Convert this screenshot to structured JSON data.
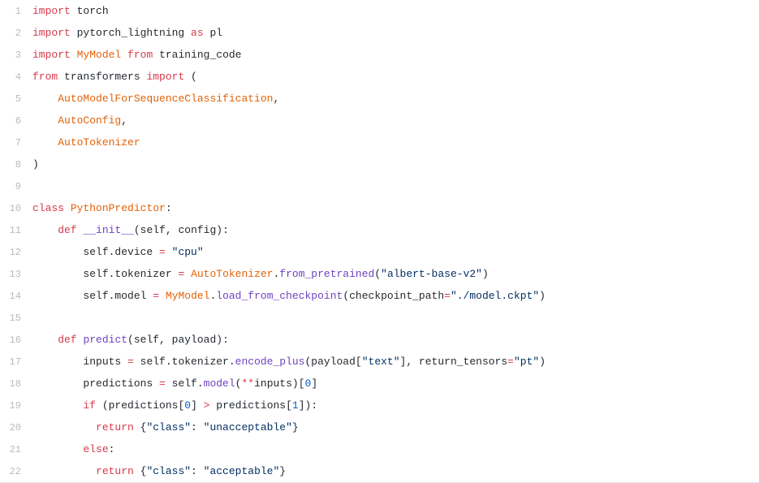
{
  "lines": [
    {
      "n": "1",
      "tokens": [
        {
          "c": "kw",
          "t": "import"
        },
        {
          "c": "plain",
          "t": " torch"
        }
      ]
    },
    {
      "n": "2",
      "tokens": [
        {
          "c": "kw",
          "t": "import"
        },
        {
          "c": "plain",
          "t": " pytorch_lightning "
        },
        {
          "c": "kw",
          "t": "as"
        },
        {
          "c": "plain",
          "t": " pl"
        }
      ]
    },
    {
      "n": "3",
      "tokens": [
        {
          "c": "kw",
          "t": "import"
        },
        {
          "c": "plain",
          "t": " "
        },
        {
          "c": "cls",
          "t": "MyModel"
        },
        {
          "c": "plain",
          "t": " "
        },
        {
          "c": "kw",
          "t": "from"
        },
        {
          "c": "plain",
          "t": " training_code"
        }
      ]
    },
    {
      "n": "4",
      "tokens": [
        {
          "c": "kw",
          "t": "from"
        },
        {
          "c": "plain",
          "t": " transformers "
        },
        {
          "c": "kw",
          "t": "import"
        },
        {
          "c": "plain",
          "t": " ("
        }
      ]
    },
    {
      "n": "5",
      "tokens": [
        {
          "c": "plain",
          "t": "    "
        },
        {
          "c": "cls",
          "t": "AutoModelForSequenceClassification"
        },
        {
          "c": "plain",
          "t": ","
        }
      ]
    },
    {
      "n": "6",
      "tokens": [
        {
          "c": "plain",
          "t": "    "
        },
        {
          "c": "cls",
          "t": "AutoConfig"
        },
        {
          "c": "plain",
          "t": ","
        }
      ]
    },
    {
      "n": "7",
      "tokens": [
        {
          "c": "plain",
          "t": "    "
        },
        {
          "c": "cls",
          "t": "AutoTokenizer"
        }
      ]
    },
    {
      "n": "8",
      "tokens": [
        {
          "c": "plain",
          "t": ")"
        }
      ]
    },
    {
      "n": "9",
      "tokens": [
        {
          "c": "plain",
          "t": ""
        }
      ]
    },
    {
      "n": "10",
      "tokens": [
        {
          "c": "kw",
          "t": "class"
        },
        {
          "c": "plain",
          "t": " "
        },
        {
          "c": "cls",
          "t": "PythonPredictor"
        },
        {
          "c": "plain",
          "t": ":"
        }
      ]
    },
    {
      "n": "11",
      "tokens": [
        {
          "c": "plain",
          "t": "    "
        },
        {
          "c": "kw",
          "t": "def"
        },
        {
          "c": "plain",
          "t": " "
        },
        {
          "c": "fn",
          "t": "__init__"
        },
        {
          "c": "plain",
          "t": "(self, config):"
        }
      ]
    },
    {
      "n": "12",
      "tokens": [
        {
          "c": "plain",
          "t": "        self.device "
        },
        {
          "c": "kw",
          "t": "="
        },
        {
          "c": "plain",
          "t": " "
        },
        {
          "c": "str",
          "t": "\"cpu\""
        }
      ]
    },
    {
      "n": "13",
      "tokens": [
        {
          "c": "plain",
          "t": "        self.tokenizer "
        },
        {
          "c": "kw",
          "t": "="
        },
        {
          "c": "plain",
          "t": " "
        },
        {
          "c": "cls",
          "t": "AutoTokenizer"
        },
        {
          "c": "plain",
          "t": "."
        },
        {
          "c": "fn",
          "t": "from_pretrained"
        },
        {
          "c": "plain",
          "t": "("
        },
        {
          "c": "str",
          "t": "\"albert-base-v2\""
        },
        {
          "c": "plain",
          "t": ")"
        }
      ]
    },
    {
      "n": "14",
      "tokens": [
        {
          "c": "plain",
          "t": "        self.model "
        },
        {
          "c": "kw",
          "t": "="
        },
        {
          "c": "plain",
          "t": " "
        },
        {
          "c": "cls",
          "t": "MyModel"
        },
        {
          "c": "plain",
          "t": "."
        },
        {
          "c": "fn",
          "t": "load_from_checkpoint"
        },
        {
          "c": "plain",
          "t": "(checkpoint_path"
        },
        {
          "c": "kw",
          "t": "="
        },
        {
          "c": "str",
          "t": "\"./model.ckpt\""
        },
        {
          "c": "plain",
          "t": ")"
        }
      ]
    },
    {
      "n": "15",
      "tokens": [
        {
          "c": "plain",
          "t": ""
        }
      ]
    },
    {
      "n": "16",
      "tokens": [
        {
          "c": "plain",
          "t": "    "
        },
        {
          "c": "kw",
          "t": "def"
        },
        {
          "c": "plain",
          "t": " "
        },
        {
          "c": "fn",
          "t": "predict"
        },
        {
          "c": "plain",
          "t": "(self, payload):"
        }
      ]
    },
    {
      "n": "17",
      "tokens": [
        {
          "c": "plain",
          "t": "        inputs "
        },
        {
          "c": "kw",
          "t": "="
        },
        {
          "c": "plain",
          "t": " self.tokenizer."
        },
        {
          "c": "fn",
          "t": "encode_plus"
        },
        {
          "c": "plain",
          "t": "(payload["
        },
        {
          "c": "str",
          "t": "\"text\""
        },
        {
          "c": "plain",
          "t": "], return_tensors"
        },
        {
          "c": "kw",
          "t": "="
        },
        {
          "c": "str",
          "t": "\"pt\""
        },
        {
          "c": "plain",
          "t": ")"
        }
      ]
    },
    {
      "n": "18",
      "tokens": [
        {
          "c": "plain",
          "t": "        predictions "
        },
        {
          "c": "kw",
          "t": "="
        },
        {
          "c": "plain",
          "t": " self."
        },
        {
          "c": "fn",
          "t": "model"
        },
        {
          "c": "plain",
          "t": "("
        },
        {
          "c": "kw",
          "t": "**"
        },
        {
          "c": "plain",
          "t": "inputs)["
        },
        {
          "c": "num",
          "t": "0"
        },
        {
          "c": "plain",
          "t": "]"
        }
      ]
    },
    {
      "n": "19",
      "tokens": [
        {
          "c": "plain",
          "t": "        "
        },
        {
          "c": "kw",
          "t": "if"
        },
        {
          "c": "plain",
          "t": " (predictions["
        },
        {
          "c": "num",
          "t": "0"
        },
        {
          "c": "plain",
          "t": "] "
        },
        {
          "c": "kw",
          "t": ">"
        },
        {
          "c": "plain",
          "t": " predictions["
        },
        {
          "c": "num",
          "t": "1"
        },
        {
          "c": "plain",
          "t": "]):"
        }
      ]
    },
    {
      "n": "20",
      "tokens": [
        {
          "c": "plain",
          "t": "          "
        },
        {
          "c": "kw",
          "t": "return"
        },
        {
          "c": "plain",
          "t": " {"
        },
        {
          "c": "str",
          "t": "\"class\""
        },
        {
          "c": "plain",
          "t": ": "
        },
        {
          "c": "str",
          "t": "\"unacceptable\""
        },
        {
          "c": "plain",
          "t": "}"
        }
      ]
    },
    {
      "n": "21",
      "tokens": [
        {
          "c": "plain",
          "t": "        "
        },
        {
          "c": "kw",
          "t": "else"
        },
        {
          "c": "plain",
          "t": ":"
        }
      ]
    },
    {
      "n": "22",
      "tokens": [
        {
          "c": "plain",
          "t": "          "
        },
        {
          "c": "kw",
          "t": "return"
        },
        {
          "c": "plain",
          "t": " {"
        },
        {
          "c": "str",
          "t": "\"class\""
        },
        {
          "c": "plain",
          "t": ": "
        },
        {
          "c": "str",
          "t": "\"acceptable\""
        },
        {
          "c": "plain",
          "t": "}"
        }
      ]
    }
  ]
}
